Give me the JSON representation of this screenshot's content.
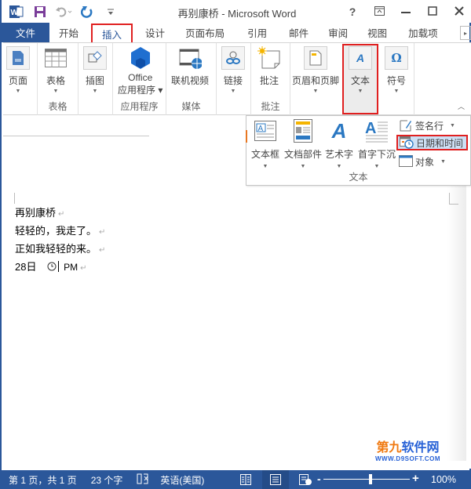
{
  "window": {
    "title": "再别康桥 - Microsoft Word",
    "controls": {
      "help": "?",
      "ribbon_display": "⊼",
      "minimize": "—",
      "maximize": "☐",
      "close": "✕"
    }
  },
  "quick_access": {
    "word_icon": "W",
    "save": "save-icon",
    "undo": "undo-icon",
    "redo": "redo-icon",
    "customize": "="
  },
  "tabs": [
    {
      "label": "文件",
      "type": "file"
    },
    {
      "label": "开始"
    },
    {
      "label": "插入",
      "active": true
    },
    {
      "label": "设计"
    },
    {
      "label": "页面布局"
    },
    {
      "label": "引用"
    },
    {
      "label": "邮件"
    },
    {
      "label": "审阅"
    },
    {
      "label": "视图"
    },
    {
      "label": "加载项"
    }
  ],
  "ribbon": {
    "groups": {
      "pages": {
        "button": "页面",
        "label": ""
      },
      "tables": {
        "button": "表格",
        "label": "表格"
      },
      "illustrations": {
        "button": "插图",
        "label": ""
      },
      "apps": {
        "button_line1": "Office",
        "button_line2": "应用程序",
        "label": "应用程序"
      },
      "media": {
        "button": "联机视频",
        "label": "媒体"
      },
      "links": {
        "button": "链接",
        "label": ""
      },
      "comments": {
        "button": "批注",
        "label": "批注"
      },
      "header_footer": {
        "button": "页眉和页脚",
        "label": ""
      },
      "text": {
        "button": "文本",
        "label": ""
      },
      "symbols": {
        "button": "符号",
        "label": ""
      }
    }
  },
  "text_dropdown": {
    "items": [
      {
        "label": "文本框"
      },
      {
        "label": "文档部件"
      },
      {
        "label": "艺术字"
      },
      {
        "label": "首字下沉"
      }
    ],
    "small_items": [
      {
        "label": "签名行"
      },
      {
        "label": "日期和时间",
        "highlighted": true
      },
      {
        "label": "对象"
      }
    ],
    "group_label": "文本"
  },
  "document": {
    "lines": [
      {
        "text": "再别康桥"
      },
      {
        "text": "轻轻的，我走了。"
      },
      {
        "text": "正如我轻轻的来。"
      },
      {
        "text_before": "28日",
        "text_after": "PM"
      }
    ]
  },
  "watermark": {
    "cn_orange": "第九",
    "cn_blue": "软件网",
    "en": "WWW.D9SOFT.COM"
  },
  "status_bar": {
    "page": "第 1 页，共 1 页",
    "words": "23 个字",
    "language": "英语(美国)",
    "zoom_minus": "-",
    "zoom_plus": "+",
    "zoom_level": "100%",
    "zoom_percent": 100
  }
}
